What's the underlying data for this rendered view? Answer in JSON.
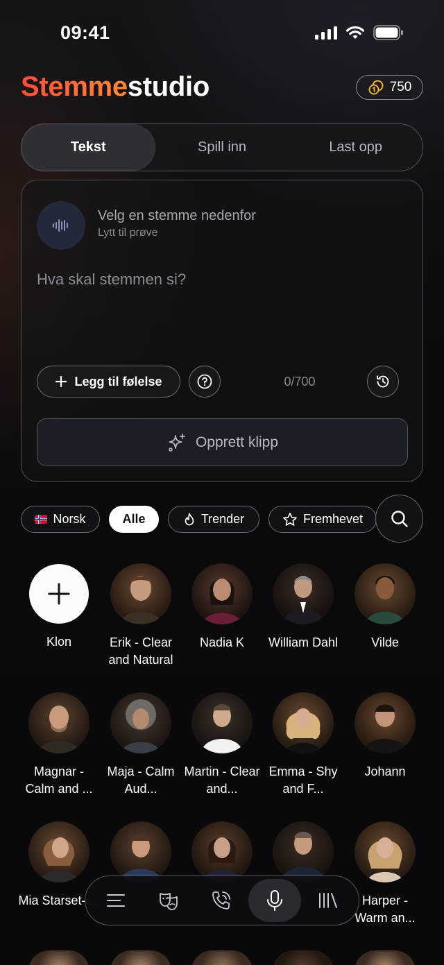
{
  "status_bar": {
    "time": "09:41"
  },
  "header": {
    "brand_part1": "Stemme",
    "brand_part2": "studio",
    "credits": "750"
  },
  "tabs": [
    {
      "label": "Tekst",
      "active": true
    },
    {
      "label": "Spill inn",
      "active": false
    },
    {
      "label": "Last opp",
      "active": false
    }
  ],
  "editor": {
    "voice_title": "Velg en stemme nedenfor",
    "voice_subtitle": "Lytt til prøve",
    "placeholder": "Hva skal stemmen si?",
    "add_emotion_label": "Legg til følelse",
    "char_count": "0/700",
    "create_label": "Opprett klipp"
  },
  "filters": {
    "language": "Norsk",
    "all": "Alle",
    "trending": "Trender",
    "featured": "Fremhevet"
  },
  "voices": [
    {
      "name": "Klon",
      "type": "add"
    },
    {
      "name": "Erik - Clear and Natural"
    },
    {
      "name": "Nadia K"
    },
    {
      "name": "William Dahl"
    },
    {
      "name": "Vilde"
    },
    {
      "name": "Magnar - Calm and ..."
    },
    {
      "name": "Maja - Calm Aud..."
    },
    {
      "name": "Martin - Clear and..."
    },
    {
      "name": "Emma - Shy and F..."
    },
    {
      "name": "Johann"
    },
    {
      "name": "Mia Starset- ..."
    },
    {
      "name": ""
    },
    {
      "name": ""
    },
    {
      "name": ""
    },
    {
      "name": "Harper - Warm an..."
    }
  ],
  "bottom_nav": [
    "menu-icon",
    "theater-masks-icon",
    "phone-call-icon",
    "microphone-icon",
    "library-icon"
  ],
  "colors": {
    "accent": "#ff5a36",
    "background": "#0b0b0f"
  }
}
